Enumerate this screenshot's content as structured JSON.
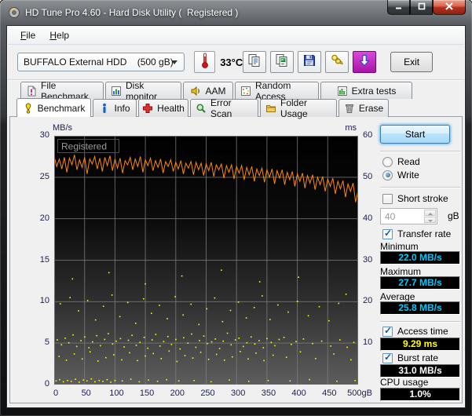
{
  "window": {
    "title": "HD Tune Pro 4.60 - Hard Disk Utility (  Registered )",
    "controls": [
      {
        "name": "minimize",
        "icon": "minimize"
      },
      {
        "name": "maximize",
        "icon": "maximize"
      },
      {
        "name": "close",
        "icon": "close"
      }
    ]
  },
  "menu": {
    "items": [
      "File",
      "Help"
    ]
  },
  "toolbar": {
    "drive_select": {
      "value": "BUFFALO External HDD    (500 gB)"
    },
    "temperature": "33°C",
    "buttons": [
      {
        "name": "copy-text",
        "icon": "copy-text"
      },
      {
        "name": "copy-image",
        "icon": "copy-image"
      },
      {
        "name": "save",
        "icon": "save"
      },
      {
        "name": "options",
        "icon": "options"
      },
      {
        "name": "download",
        "icon": "download"
      }
    ],
    "exit_label": "Exit"
  },
  "tabs": {
    "row1": [
      {
        "label": "File Benchmark",
        "icon": "file-benchmark",
        "active": false
      },
      {
        "label": "Disk monitor",
        "icon": "disk-monitor",
        "active": false
      },
      {
        "label": "AAM",
        "icon": "aam",
        "active": false
      },
      {
        "label": "Random Access",
        "icon": "random-access",
        "active": false
      },
      {
        "label": "Extra tests",
        "icon": "extra-tests",
        "active": false
      }
    ],
    "row2": [
      {
        "label": "Benchmark",
        "icon": "benchmark",
        "active": true
      },
      {
        "label": "Info",
        "icon": "info",
        "active": false
      },
      {
        "label": "Health",
        "icon": "health",
        "active": false
      },
      {
        "label": "Error Scan",
        "icon": "error-scan",
        "active": false
      },
      {
        "label": "Folder Usage",
        "icon": "folder-usage",
        "active": false
      },
      {
        "label": "Erase",
        "icon": "erase",
        "active": false
      }
    ]
  },
  "panel": {
    "start_label": "Start",
    "read_radio": {
      "label": "Read",
      "checked": false
    },
    "write_radio": {
      "label": "Write",
      "checked": true
    },
    "short_stroke": {
      "label": "Short stroke",
      "checked": false,
      "size_value": "40",
      "unit": "gB"
    },
    "transfer_rate": {
      "label": "Transfer rate",
      "checked": true,
      "minimum": {
        "label": "Minimum",
        "value": "22.0 MB/s"
      },
      "maximum": {
        "label": "Maximum",
        "value": "27.7 MB/s"
      },
      "average": {
        "label": "Average",
        "value": "25.8 MB/s"
      }
    },
    "access_time": {
      "label": "Access time",
      "checked": true,
      "value": "9.29 ms"
    },
    "burst_rate": {
      "label": "Burst rate",
      "checked": true,
      "value": "31.0 MB/s"
    },
    "cpu_usage": {
      "label": "CPU usage",
      "value": "1.0%"
    }
  },
  "glyphs": {
    "check": "✓"
  },
  "colors": {
    "value_cyan": "#00c8ff",
    "value_yellow": "#ffff00",
    "value_white": "#ffffff",
    "transfer_orange": "#ff8a00",
    "access_yellow": "#ffff00",
    "download_magenta": "#a814a8"
  },
  "chart_data": {
    "type": "line+scatter",
    "watermark": "Registered",
    "grid": true,
    "background": {
      "top": "#000000",
      "bottom": "#5d5d5d"
    },
    "x_axis": {
      "unit": "gB",
      "min": 0,
      "max": 500,
      "ticks": [
        0,
        50,
        100,
        150,
        200,
        250,
        300,
        350,
        400,
        450,
        500
      ]
    },
    "left_axis": {
      "label": "MB/s",
      "min": 0,
      "max": 30,
      "ticks": [
        30,
        25,
        20,
        15,
        10,
        5,
        0
      ]
    },
    "right_axis": {
      "label": "ms",
      "min": 0,
      "max": 60,
      "ticks": [
        60,
        50,
        40,
        30,
        20,
        10
      ]
    },
    "series": [
      {
        "name": "transfer-rate",
        "type": "line",
        "axis": "left",
        "color": "#ff8a00",
        "x_step": 4.1667,
        "values": [
          27.5,
          26.3,
          27.2,
          26.0,
          27.4,
          25.6,
          27.3,
          26.5,
          27.7,
          25.9,
          27.1,
          26.2,
          27.4,
          25.4,
          27.2,
          26.6,
          27.5,
          26.0,
          27.3,
          25.7,
          27.4,
          26.4,
          27.6,
          25.8,
          27.2,
          26.1,
          27.3,
          25.5,
          27.0,
          26.5,
          27.4,
          25.9,
          27.2,
          26.3,
          27.5,
          25.6,
          27.1,
          26.4,
          27.3,
          25.8,
          27.0,
          26.2,
          27.2,
          25.5,
          26.9,
          26.3,
          27.1,
          25.7,
          26.8,
          26.0,
          27.0,
          25.4,
          26.7,
          26.1,
          26.9,
          25.3,
          26.8,
          25.9,
          26.7,
          25.2,
          26.6,
          25.8,
          26.8,
          25.1,
          26.5,
          25.9,
          26.6,
          24.9,
          26.4,
          25.6,
          26.5,
          24.8,
          26.3,
          25.5,
          26.4,
          24.7,
          26.2,
          25.3,
          26.3,
          24.5,
          26.0,
          25.2,
          26.1,
          24.4,
          25.9,
          25.0,
          26.0,
          24.2,
          25.8,
          24.9,
          25.9,
          24.1,
          25.6,
          24.7,
          25.7,
          23.9,
          25.4,
          24.5,
          25.5,
          23.7,
          25.2,
          24.3,
          25.3,
          23.5,
          25.0,
          24.1,
          25.1,
          23.3,
          24.8,
          23.9,
          24.9,
          23.0,
          24.5,
          23.6,
          24.6,
          22.6,
          24.2,
          23.3,
          24.3,
          22.0,
          23.4
        ]
      },
      {
        "name": "access-time",
        "type": "scatter",
        "axis": "right",
        "color": "#ffff00",
        "points": [
          [
            5,
            10.8
          ],
          [
            12,
            9.6
          ],
          [
            18,
            11.2
          ],
          [
            24,
            10.1
          ],
          [
            31,
            12.0
          ],
          [
            37,
            9.2
          ],
          [
            44,
            10.6
          ],
          [
            50,
            11.5
          ],
          [
            57,
            8.9
          ],
          [
            63,
            10.3
          ],
          [
            70,
            11.8
          ],
          [
            76,
            9.4
          ],
          [
            83,
            10.9
          ],
          [
            89,
            12.3
          ],
          [
            96,
            9.8
          ],
          [
            102,
            10.5
          ],
          [
            109,
            11.1
          ],
          [
            115,
            9.1
          ],
          [
            122,
            10.7
          ],
          [
            128,
            11.9
          ],
          [
            135,
            9.5
          ],
          [
            141,
            10.2
          ],
          [
            148,
            11.4
          ],
          [
            154,
            8.8
          ],
          [
            161,
            10.8
          ],
          [
            167,
            12.1
          ],
          [
            174,
            9.3
          ],
          [
            180,
            10.4
          ],
          [
            187,
            11.6
          ],
          [
            193,
            9.7
          ],
          [
            200,
            10.9
          ],
          [
            207,
            8.6
          ],
          [
            213,
            11.3
          ],
          [
            220,
            10.0
          ],
          [
            226,
            12.2
          ],
          [
            233,
            9.0
          ],
          [
            239,
            10.6
          ],
          [
            246,
            11.7
          ],
          [
            252,
            9.9
          ],
          [
            259,
            10.3
          ],
          [
            265,
            11.0
          ],
          [
            272,
            8.7
          ],
          [
            278,
            10.5
          ],
          [
            285,
            12.4
          ],
          [
            291,
            9.6
          ],
          [
            298,
            10.8
          ],
          [
            304,
            11.2
          ],
          [
            311,
            9.2
          ],
          [
            317,
            10.1
          ],
          [
            324,
            11.5
          ],
          [
            330,
            9.8
          ],
          [
            337,
            10.6
          ],
          [
            344,
            8.9
          ],
          [
            350,
            11.1
          ],
          [
            357,
            10.2
          ],
          [
            363,
            9.4
          ],
          [
            370,
            10.9
          ],
          [
            378,
            11.4
          ],
          [
            390,
            9.7
          ],
          [
            398,
            10.4
          ],
          [
            410,
            11.0
          ],
          [
            425,
            9.9
          ],
          [
            440,
            10.5
          ],
          [
            455,
            9.3
          ],
          [
            470,
            10.8
          ],
          [
            482,
            9.0
          ],
          [
            493,
            10.2
          ],
          [
            8,
            6.8
          ],
          [
            20,
            5.9
          ],
          [
            33,
            7.4
          ],
          [
            46,
            6.2
          ],
          [
            59,
            7.9
          ],
          [
            72,
            5.7
          ],
          [
            85,
            6.5
          ],
          [
            98,
            7.2
          ],
          [
            111,
            6.0
          ],
          [
            124,
            7.7
          ],
          [
            137,
            5.8
          ],
          [
            150,
            6.9
          ],
          [
            163,
            7.5
          ],
          [
            176,
            6.3
          ],
          [
            189,
            8.1
          ],
          [
            202,
            5.6
          ],
          [
            215,
            7.0
          ],
          [
            228,
            6.4
          ],
          [
            241,
            7.8
          ],
          [
            254,
            6.1
          ],
          [
            267,
            7.3
          ],
          [
            280,
            5.9
          ],
          [
            293,
            6.7
          ],
          [
            306,
            8.0
          ],
          [
            319,
            6.2
          ],
          [
            332,
            7.6
          ],
          [
            345,
            5.8
          ],
          [
            360,
            7.1
          ],
          [
            382,
            6.6
          ],
          [
            405,
            7.9
          ],
          [
            430,
            6.3
          ],
          [
            460,
            7.4
          ],
          [
            488,
            6.0
          ],
          [
            10,
            19.5
          ],
          [
            26,
            21.0
          ],
          [
            40,
            17.8
          ],
          [
            55,
            20.3
          ],
          [
            68,
            15.6
          ],
          [
            81,
            18.9
          ],
          [
            95,
            21.6
          ],
          [
            108,
            16.4
          ],
          [
            121,
            19.8
          ],
          [
            134,
            14.8
          ],
          [
            147,
            20.7
          ],
          [
            160,
            17.2
          ],
          [
            173,
            19.1
          ],
          [
            186,
            15.9
          ],
          [
            199,
            21.2
          ],
          [
            212,
            16.8
          ],
          [
            225,
            19.4
          ],
          [
            238,
            14.5
          ],
          [
            251,
            18.3
          ],
          [
            264,
            20.9
          ],
          [
            277,
            15.2
          ],
          [
            290,
            17.9
          ],
          [
            303,
            19.9
          ],
          [
            316,
            16.1
          ],
          [
            329,
            18.6
          ],
          [
            342,
            21.4
          ],
          [
            355,
            15.7
          ],
          [
            368,
            19.2
          ],
          [
            385,
            17.5
          ],
          [
            400,
            20.1
          ],
          [
            418,
            16.6
          ],
          [
            436,
            18.8
          ],
          [
            452,
            15.4
          ],
          [
            468,
            19.6
          ],
          [
            480,
            21.8
          ],
          [
            3,
            0.9
          ],
          [
            9,
            1.2
          ],
          [
            15,
            0.7
          ],
          [
            22,
            1.0
          ],
          [
            28,
            0.8
          ],
          [
            35,
            1.3
          ],
          [
            41,
            0.6
          ],
          [
            48,
            1.1
          ],
          [
            54,
            0.9
          ],
          [
            61,
            1.4
          ],
          [
            67,
            0.7
          ],
          [
            74,
            1.0
          ],
          [
            80,
            0.8
          ],
          [
            87,
            1.2
          ],
          [
            93,
            0.6
          ],
          [
            100,
            1.0
          ],
          [
            112,
            0.9
          ],
          [
            126,
            1.3
          ],
          [
            140,
            0.7
          ],
          [
            155,
            1.1
          ],
          [
            170,
            0.8
          ],
          [
            185,
            1.2
          ],
          [
            205,
            0.9
          ],
          [
            230,
            1.0
          ],
          [
            258,
            0.7
          ],
          [
            288,
            1.1
          ],
          [
            320,
            0.8
          ],
          [
            352,
            1.0
          ],
          [
            388,
            0.9
          ],
          [
            420,
            1.2
          ],
          [
            465,
            0.8
          ],
          [
            495,
            1.0
          ],
          [
            30,
            25.5
          ],
          [
            90,
            27.0
          ],
          [
            150,
            24.3
          ],
          [
            210,
            26.2
          ],
          [
            275,
            27.6
          ],
          [
            338,
            24.8
          ],
          [
            402,
            25.9
          ]
        ]
      }
    ]
  }
}
